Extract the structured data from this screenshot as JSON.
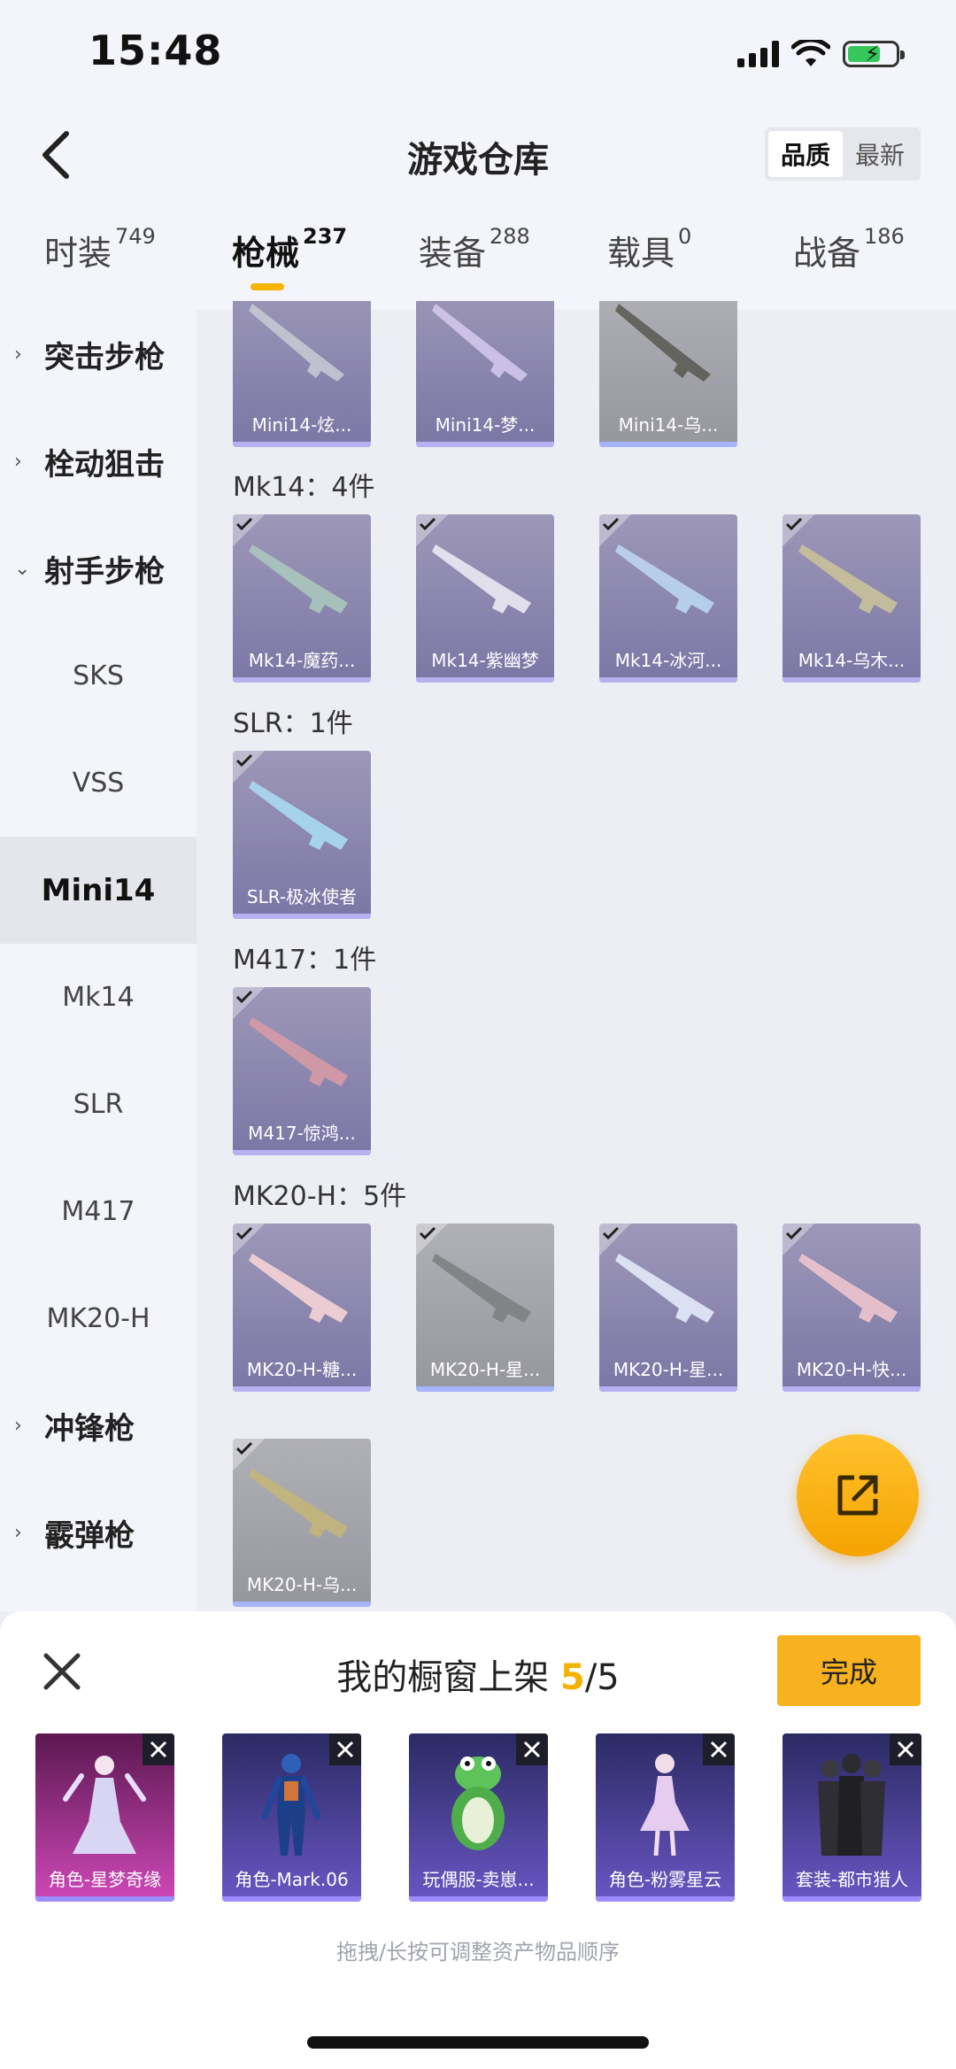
{
  "status": {
    "time": "15:48"
  },
  "header": {
    "title": "游戏仓库",
    "sort": [
      "品质",
      "最新"
    ]
  },
  "tabs": [
    {
      "label": "时装",
      "count": "749"
    },
    {
      "label": "枪械",
      "count": "237"
    },
    {
      "label": "装备",
      "count": "288"
    },
    {
      "label": "载具",
      "count": "0"
    },
    {
      "label": "战备",
      "count": "186"
    }
  ],
  "sidebar": [
    {
      "label": "突击步枪"
    },
    {
      "label": "栓动狙击"
    },
    {
      "label": "射手步枪"
    },
    {
      "label": "SKS"
    },
    {
      "label": "VSS"
    },
    {
      "label": "Mini14"
    },
    {
      "label": "Mk14"
    },
    {
      "label": "SLR"
    },
    {
      "label": "M417"
    },
    {
      "label": "MK20-H"
    },
    {
      "label": "冲锋枪"
    },
    {
      "label": "霰弹枪"
    }
  ],
  "groups": [
    "Mk14：4件",
    "SLR：1件",
    "M417：1件",
    "MK20-H：5件"
  ],
  "items": [
    "Mini14-炫...",
    "Mini14-梦...",
    "Mini14-乌...",
    "Mk14-魔药...",
    "Mk14-紫幽梦",
    "Mk14-冰河...",
    "Mk14-乌木...",
    "SLR-极冰使者",
    "M417-惊鸿...",
    "MK20-H-糖...",
    "MK20-H-星...",
    "MK20-H-星...",
    "MK20-H-快...",
    "MK20-H-乌..."
  ],
  "showcase": {
    "title_prefix": "我的橱窗上架",
    "count": "5",
    "total": "/5",
    "done_label": "完成",
    "hint": "拖拽/长按可调整资产物品顺序",
    "slots": [
      "角色-星梦奇缘",
      "角色-Mark.06",
      "玩偶服-卖崽...",
      "角色-粉雾星云",
      "套装-都市猎人"
    ]
  },
  "colors": {
    "accent": "#f6b400",
    "done_button": "#f8b11f",
    "card_purple": "#8b86ad",
    "card_gray": "#a2a3a9"
  }
}
